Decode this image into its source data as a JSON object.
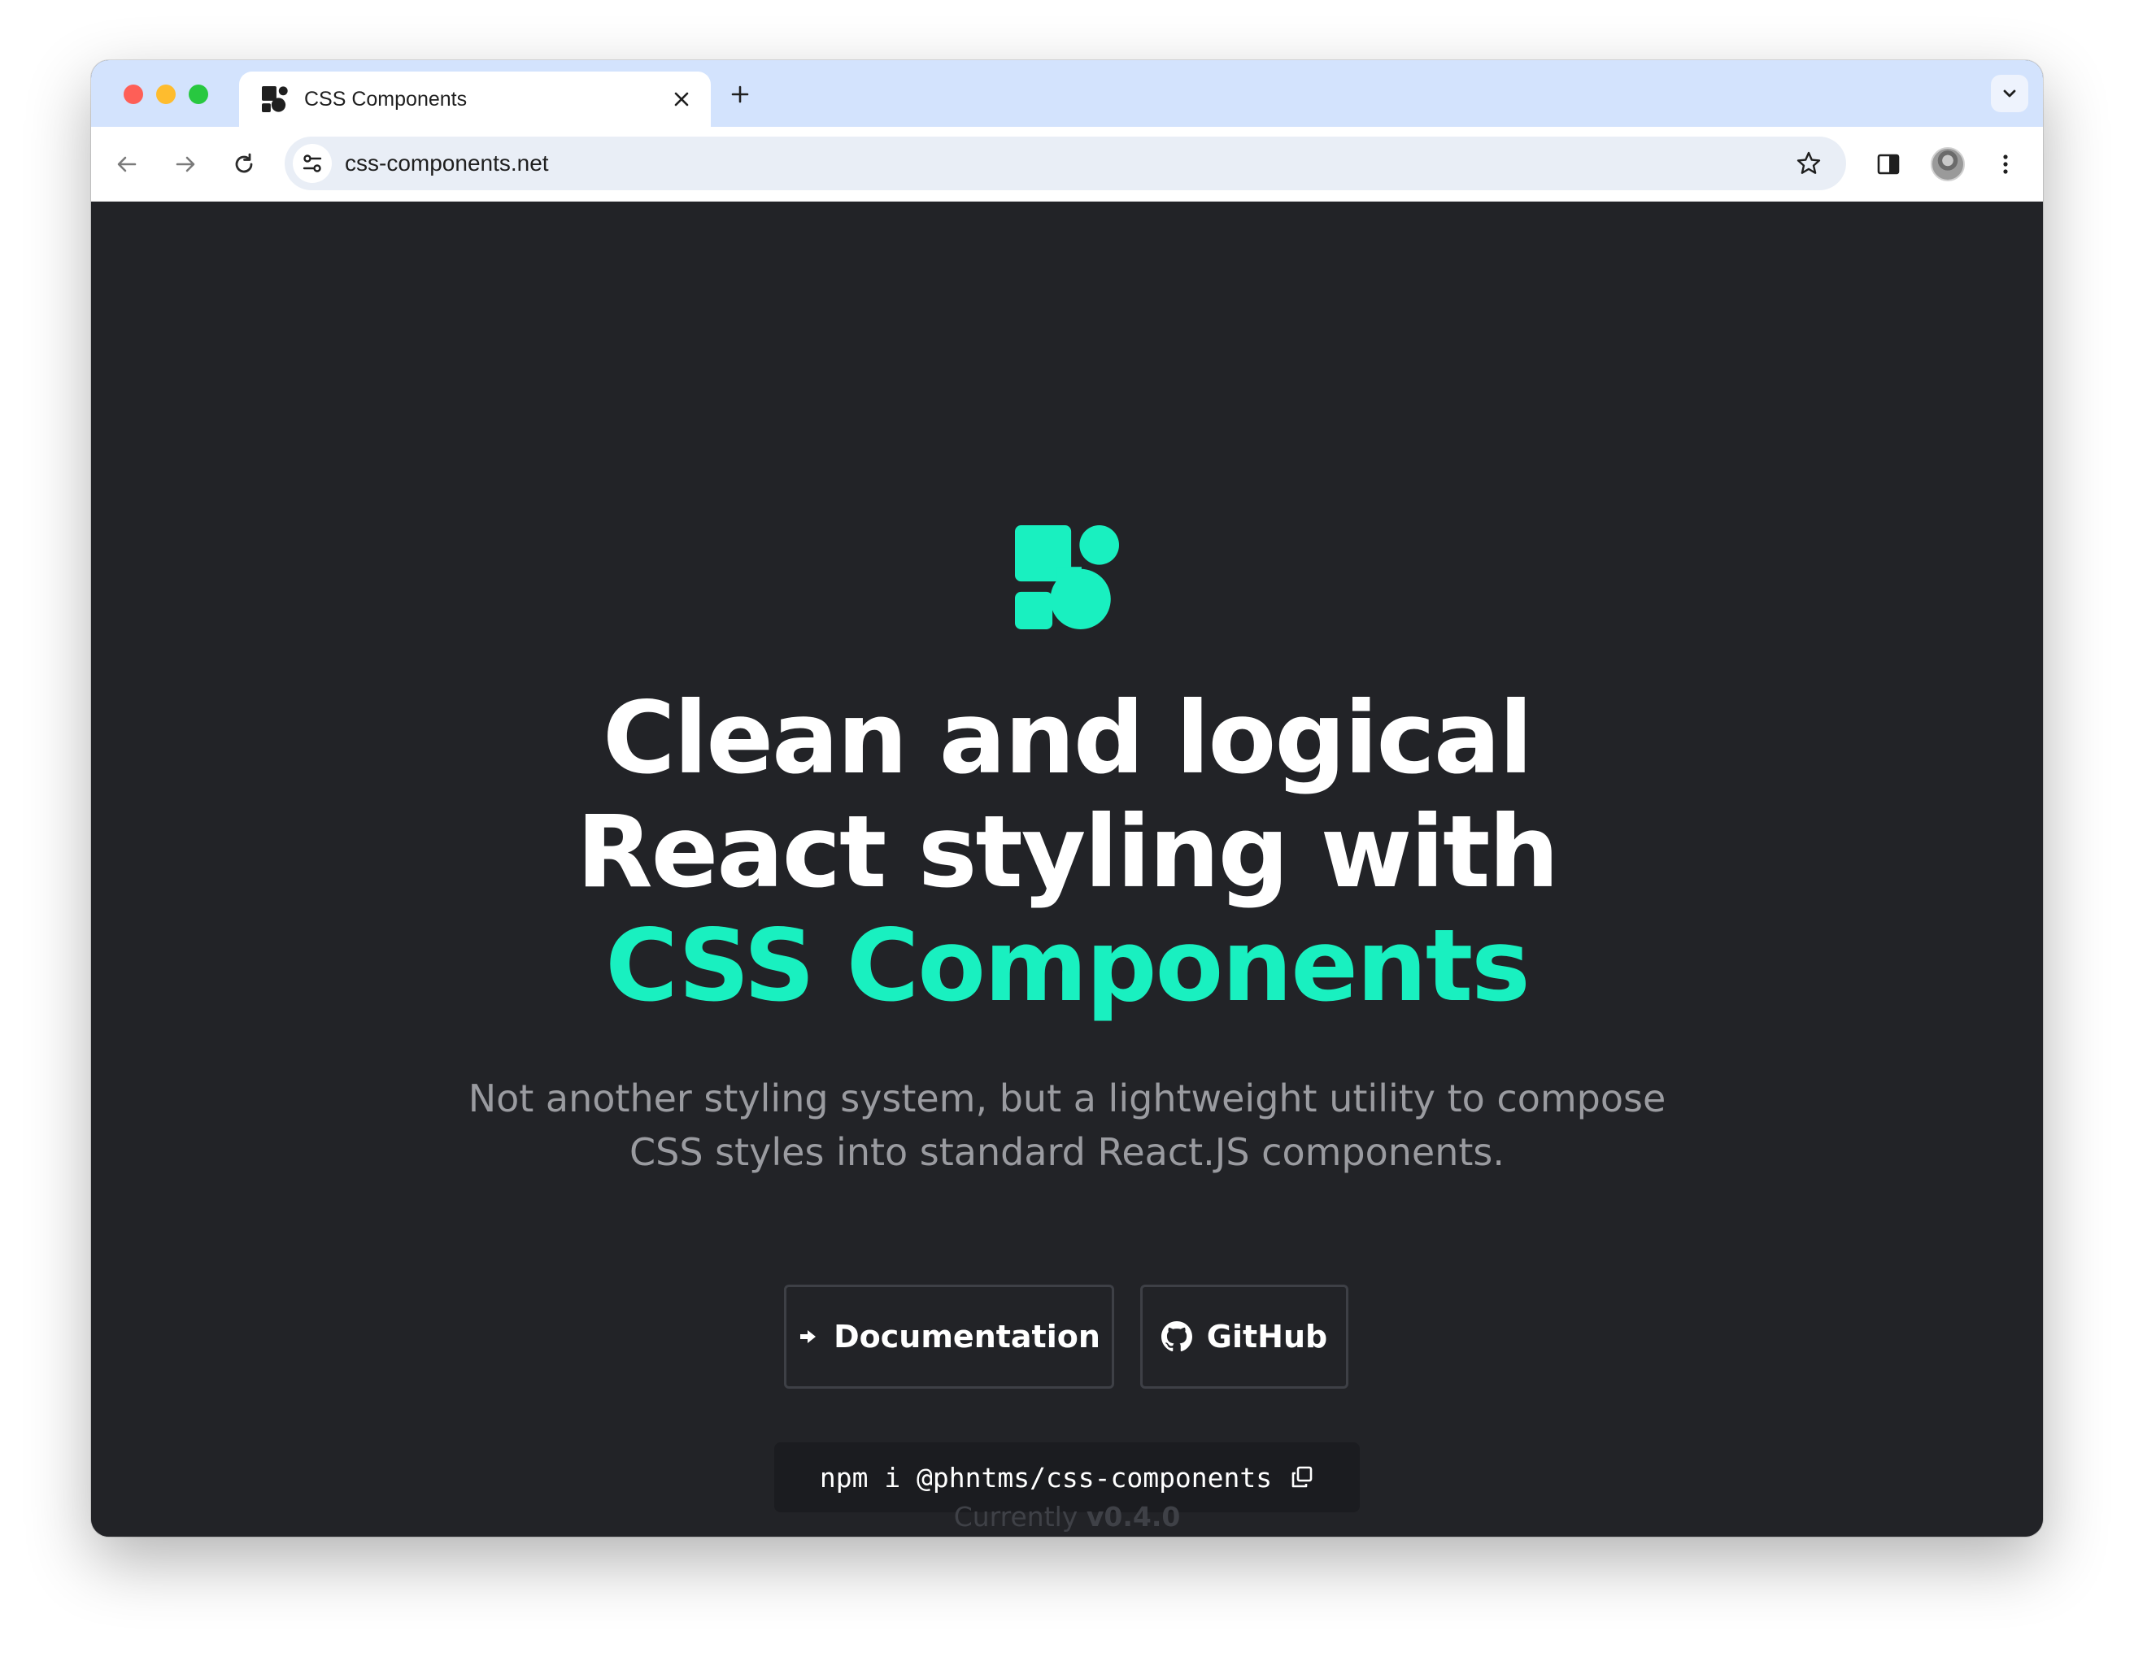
{
  "browser": {
    "tab": {
      "title": "CSS Components",
      "favicon": "css-components-logo-icon"
    },
    "url": "css-components.net",
    "icons": {
      "back": "arrow-left-icon",
      "forward": "arrow-right-icon",
      "reload": "reload-icon",
      "site_info": "tune-icon",
      "bookmark": "star-icon",
      "side_panel": "side-panel-icon",
      "menu": "kebab-menu-icon",
      "new_tab": "plus-icon",
      "tab_close": "close-icon",
      "tab_search": "chevron-down-icon"
    }
  },
  "hero": {
    "headline_line1": "Clean and logical",
    "headline_line2": "React styling with",
    "headline_accent": "CSS Components",
    "subtitle_line1": "Not another styling system, but a lightweight utility to compose",
    "subtitle_line2": "CSS styles into standard React.JS components.",
    "docs_button": "Documentation",
    "github_button": "GitHub",
    "npm_command": "npm i @phntms/css-components",
    "version_prefix": "Currently",
    "version": "v0.4.0"
  },
  "colors": {
    "accent": "#19f0c0",
    "page_background": "#222327",
    "tabstrip": "#d3e3fd"
  }
}
